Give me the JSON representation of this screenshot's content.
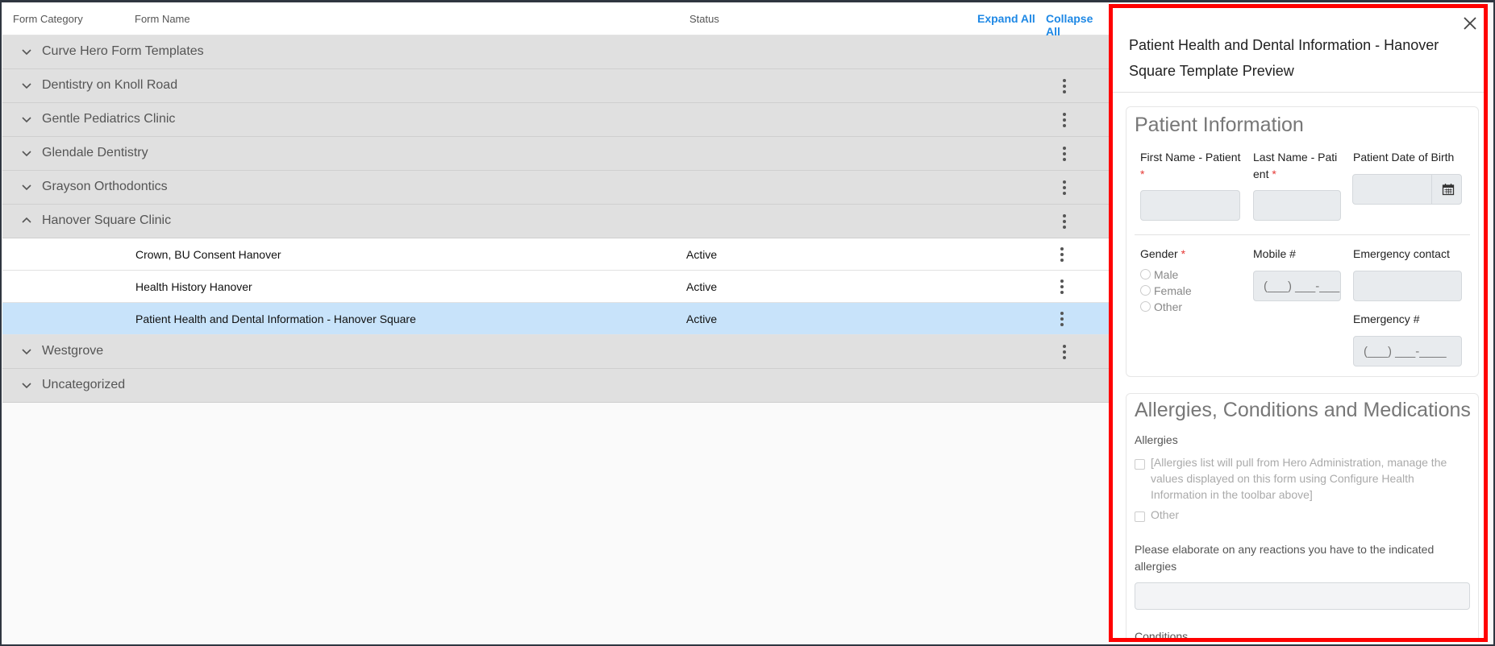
{
  "header": {
    "col_category": "Form Category",
    "col_name": "Form Name",
    "col_status": "Status",
    "expand_all": "Expand All",
    "collapse_all": "Collapse All"
  },
  "categories": [
    {
      "label": "Curve Hero Form Templates",
      "expanded": false,
      "has_menu": false
    },
    {
      "label": "Dentistry on Knoll Road",
      "expanded": false,
      "has_menu": true
    },
    {
      "label": "Gentle Pediatrics Clinic",
      "expanded": false,
      "has_menu": true
    },
    {
      "label": "Glendale Dentistry",
      "expanded": false,
      "has_menu": true
    },
    {
      "label": "Grayson Orthodontics",
      "expanded": false,
      "has_menu": true
    },
    {
      "label": "Hanover Square Clinic",
      "expanded": true,
      "has_menu": true
    },
    {
      "label": "Westgrove",
      "expanded": false,
      "has_menu": true
    },
    {
      "label": "Uncategorized",
      "expanded": false,
      "has_menu": false
    }
  ],
  "forms": [
    {
      "name": "Crown, BU Consent Hanover",
      "status": "Active",
      "selected": false
    },
    {
      "name": "Health History Hanover",
      "status": "Active",
      "selected": false
    },
    {
      "name": "Patient Health and Dental Information - Hanover Square",
      "status": "Active",
      "selected": true
    }
  ],
  "preview": {
    "title": "Patient Health and Dental Information - Hanover Square Template Preview",
    "patient_info": {
      "heading": "Patient Information",
      "first_name_label": "First Name - Patient",
      "last_name_label": "Last Name - Pati ent",
      "dob_label": "Patient Date of Birth",
      "required_mark": "*",
      "gender_label": "Gender",
      "gender_options": [
        "Male",
        "Female",
        "Other"
      ],
      "mobile_label": "Mobile #",
      "mobile_mask": "(___) ___-___",
      "emergency_contact_label": "Emergency contact",
      "emergency_number_label": "Emergency #",
      "emergency_mask": "(___) ___-____"
    },
    "allergies": {
      "heading": "Allergies, Conditions and Medications",
      "allergies_label": "Allergies",
      "allergies_note": "[Allergies list will pull from Hero Administration, manage the values displayed on this form using Configure Health Information in the toolbar above]",
      "other_label": "Other",
      "elaborate_label": "Please elaborate on any reactions you have to the indicated allergies",
      "conditions_label": "Conditions"
    }
  }
}
